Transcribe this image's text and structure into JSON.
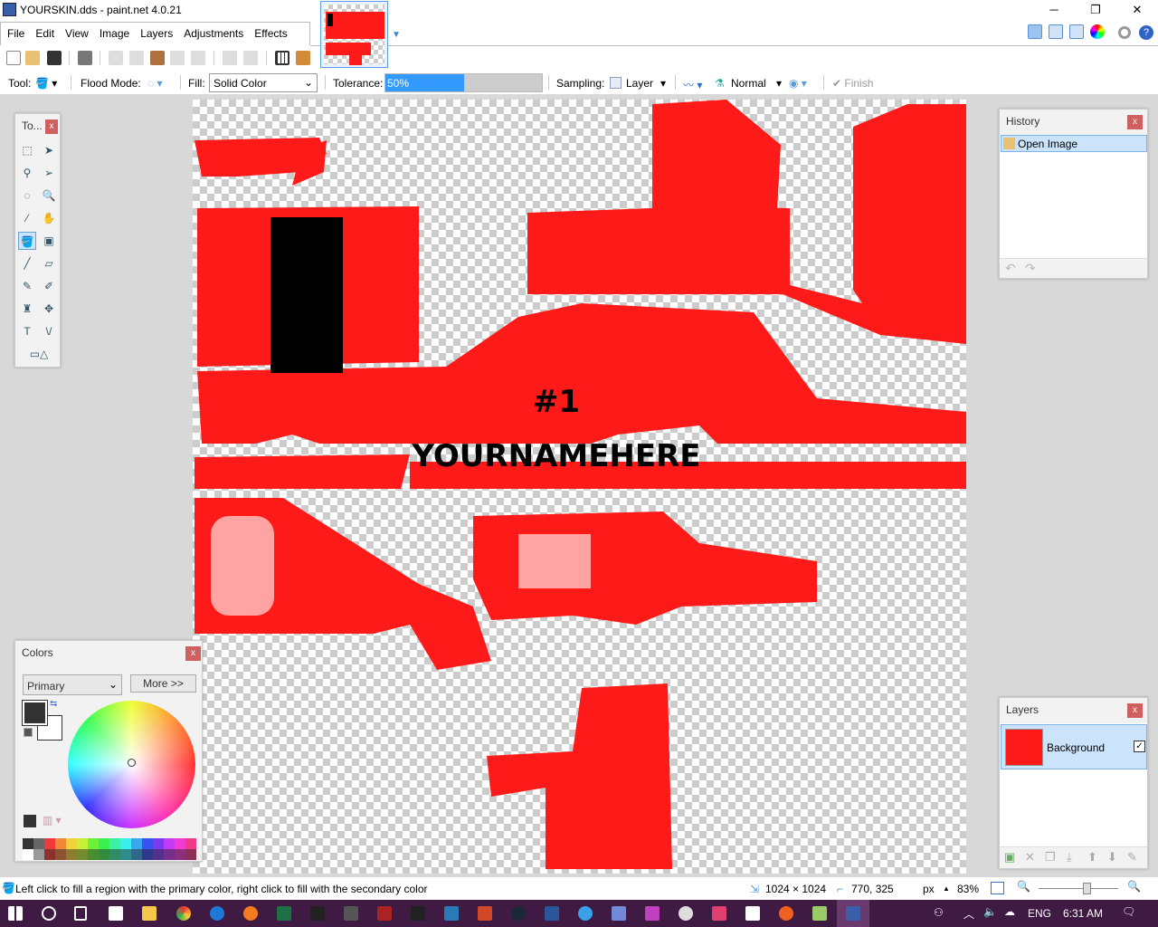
{
  "window": {
    "title": "YOURSKIN.dds - paint.net 4.0.21",
    "minimize": "─",
    "restore": "❐",
    "close": "✕"
  },
  "menu": [
    "File",
    "Edit",
    "View",
    "Image",
    "Layers",
    "Adjustments",
    "Effects"
  ],
  "tool_options": {
    "tool_label": "Tool:",
    "flood_mode_label": "Flood Mode:",
    "fill_label": "Fill:",
    "fill_value": "Solid Color",
    "tolerance_label": "Tolerance:",
    "tolerance_value": "50%",
    "tolerance_percent": 50,
    "sampling_label": "Sampling:",
    "sampling_value": "Layer",
    "blend_mode": "Normal",
    "finish": "Finish"
  },
  "canvas": {
    "number_text": "#1",
    "name_text": "YOURNAMEHERE",
    "accent": "#ff1a1a"
  },
  "tools_panel": {
    "title": "To..."
  },
  "history": {
    "title": "History",
    "items": [
      "Open Image"
    ]
  },
  "layers": {
    "title": "Layers",
    "items": [
      {
        "name": "Background",
        "visible": true
      }
    ]
  },
  "colors": {
    "title": "Colors",
    "mode": "Primary",
    "more_button": "More >>",
    "primary": "#333333",
    "secondary": "#ffffff",
    "palette_top": [
      "#333333",
      "#666666",
      "#f03a3a",
      "#f0883a",
      "#f0d23a",
      "#c6f03a",
      "#6ef03a",
      "#3af04e",
      "#3af0a6",
      "#3af0ee",
      "#3aa6f0",
      "#3a52f0",
      "#7a3af0",
      "#c43af0",
      "#f03ad2",
      "#f03a88"
    ],
    "palette_bottom": [
      "#ffffff",
      "#999999",
      "#8c3030",
      "#8c5530",
      "#8c7d30",
      "#748c30",
      "#4a8c30",
      "#308c3e",
      "#308c66",
      "#308c8c",
      "#30668c",
      "#30388c",
      "#52308c",
      "#76308c",
      "#8c307e",
      "#8c3055"
    ]
  },
  "status": {
    "hint": "Left click to fill a region with the primary color, right click to fill with the secondary color",
    "image_size": "1024 × 1024",
    "cursor_pos": "770, 325",
    "units": "px",
    "zoom": "83%",
    "zoom_slider_percent": 60
  },
  "taskbar": {
    "language": "ENG",
    "time": "6:31 AM"
  }
}
